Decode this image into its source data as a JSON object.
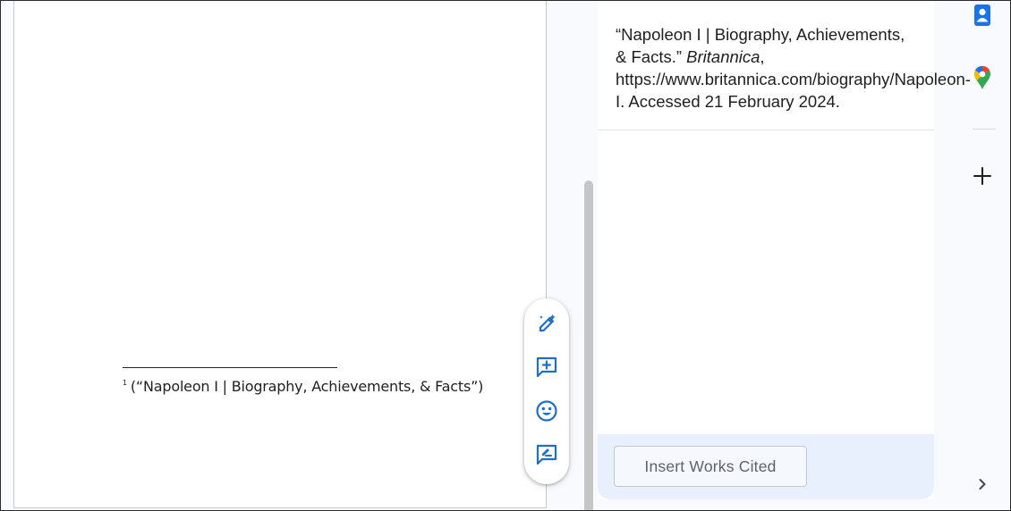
{
  "document": {
    "footnote_number": "1",
    "footnote_text": "(“Napoleon I | Biography, Achievements, & Facts”)"
  },
  "float_toolbar": {
    "icons": [
      "pen-sparkle-icon",
      "add-comment-icon",
      "emoji-icon",
      "suggest-edits-icon"
    ]
  },
  "citation_panel": {
    "citation": {
      "part1": "“Napoleon I | Biography, Achievements, & Facts.” ",
      "site_name": "Britannica",
      "part2": ", https://www.britannica.com/biography/Napoleon-I. Accessed 21 February 2024."
    },
    "insert_button_label": "Insert Works Cited"
  },
  "right_rail": {
    "icons": [
      "contacts-icon",
      "maps-icon",
      "add-icon",
      "chevron-right-icon"
    ]
  },
  "colors": {
    "accent_blue": "#1a73e8",
    "panel_footer": "#e8f0fd",
    "icon_blue": "#1f6fc5"
  }
}
